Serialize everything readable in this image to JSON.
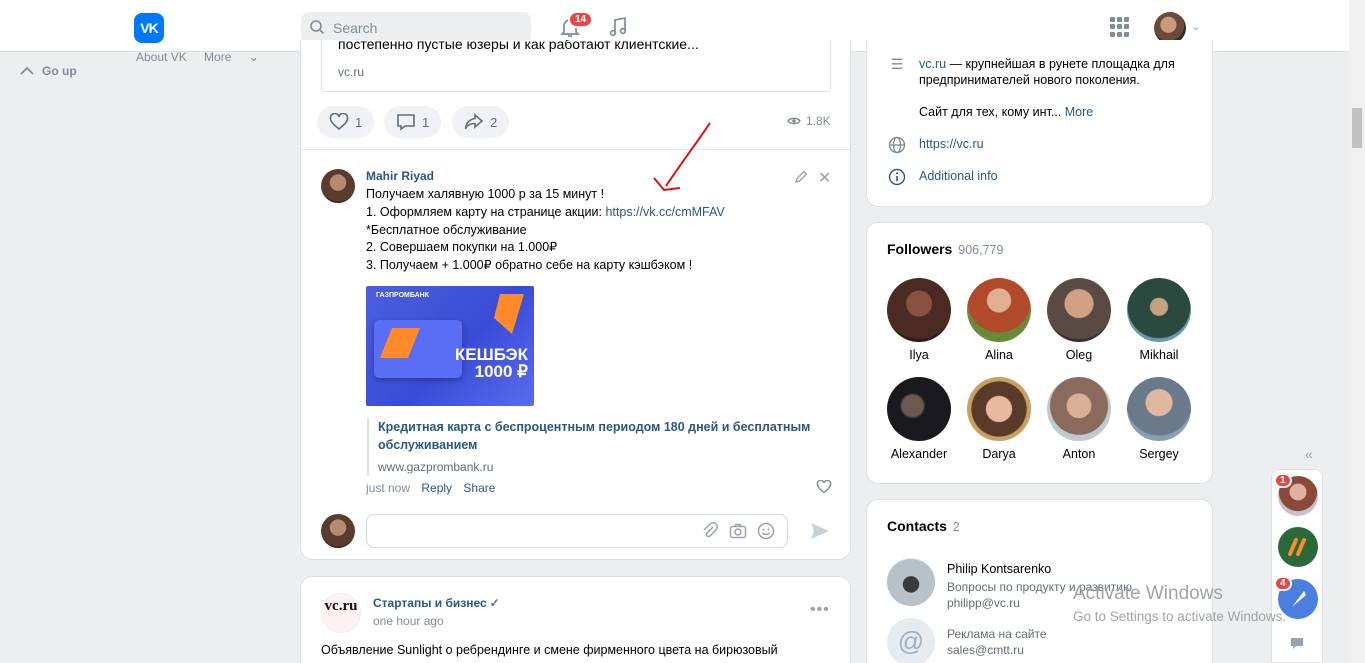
{
  "topbar": {
    "search_placeholder": "Search",
    "notifications_count": "14"
  },
  "left": {
    "about": "About VK",
    "more": "More",
    "go_up": "Go up"
  },
  "prev_post": {
    "link_title_cut": "постепенно пустые юзеры и как работают клиентские...",
    "link_domain": "vc.ru",
    "likes": "1",
    "comments": "1",
    "shares": "2",
    "views": "1.8K"
  },
  "post": {
    "author": "Mahir Riyad",
    "lines": [
      "Получаем халявную 1000 р за 15 минут !",
      "1. Оформляем карту на странице акции: ",
      "*Бесплатное обслуживание",
      "2. Совершаем покупки на 1.000₽",
      "3. Получаем + 1.000₽ обратно себе на карту кэшбэком !"
    ],
    "link": "https://vk.cc/cmMFAV",
    "image": {
      "brand": "ГАЗПРОМБАНК",
      "cashback": "КЕШБЭК",
      "amount": "1000 ₽"
    },
    "attach_title": "Кредитная карта с беспроцентным периодом 180 дней и бесплатным обслуживанием",
    "attach_domain": "www.gazprombank.ru",
    "time": "just now",
    "reply": "Reply",
    "share": "Share"
  },
  "next_post": {
    "logo": "vc.ru",
    "author": "Стартапы и бизнес",
    "time": "one hour ago",
    "text": "Объявление Sunlight о ребрендинге и смене фирменного цвета на бирюзовый"
  },
  "community_info": {
    "desc_link": "vc.ru",
    "desc_rest": " — крупнейшая в рунете площадка для предпринимателей нового поколения.",
    "desc2": "Сайт для тех, кому инт...",
    "more": "More",
    "website": "https://vc.ru",
    "additional": "Additional info"
  },
  "followers": {
    "title": "Followers",
    "count": "906,779",
    "items": [
      {
        "name": "Ilya",
        "color": "#4a2a22"
      },
      {
        "name": "Alina",
        "color": "#b04a2a"
      },
      {
        "name": "Oleg",
        "color": "#5a4a44"
      },
      {
        "name": "Mikhail",
        "color": "#2a4a40"
      },
      {
        "name": "Alexander",
        "color": "#1a1a1e"
      },
      {
        "name": "Darya",
        "color": "#c8a060"
      },
      {
        "name": "Anton",
        "color": "#8a6a5a"
      },
      {
        "name": "Sergey",
        "color": "#6a7a8a"
      }
    ]
  },
  "contacts": {
    "title": "Contacts",
    "count": "2",
    "items": [
      {
        "name": "Philip Kontsarenko",
        "desc": "Вопросы по продукту и развитию",
        "email": "philipp@vc.ru"
      },
      {
        "name": "",
        "desc": "Реклама на сайте",
        "email": "sales@cmtt.ru"
      }
    ]
  },
  "side_chats": {
    "badge1": "1",
    "badge2": "4"
  },
  "windows": {
    "line1": "Activate Windows",
    "line2": "Go to Settings to activate Windows."
  }
}
